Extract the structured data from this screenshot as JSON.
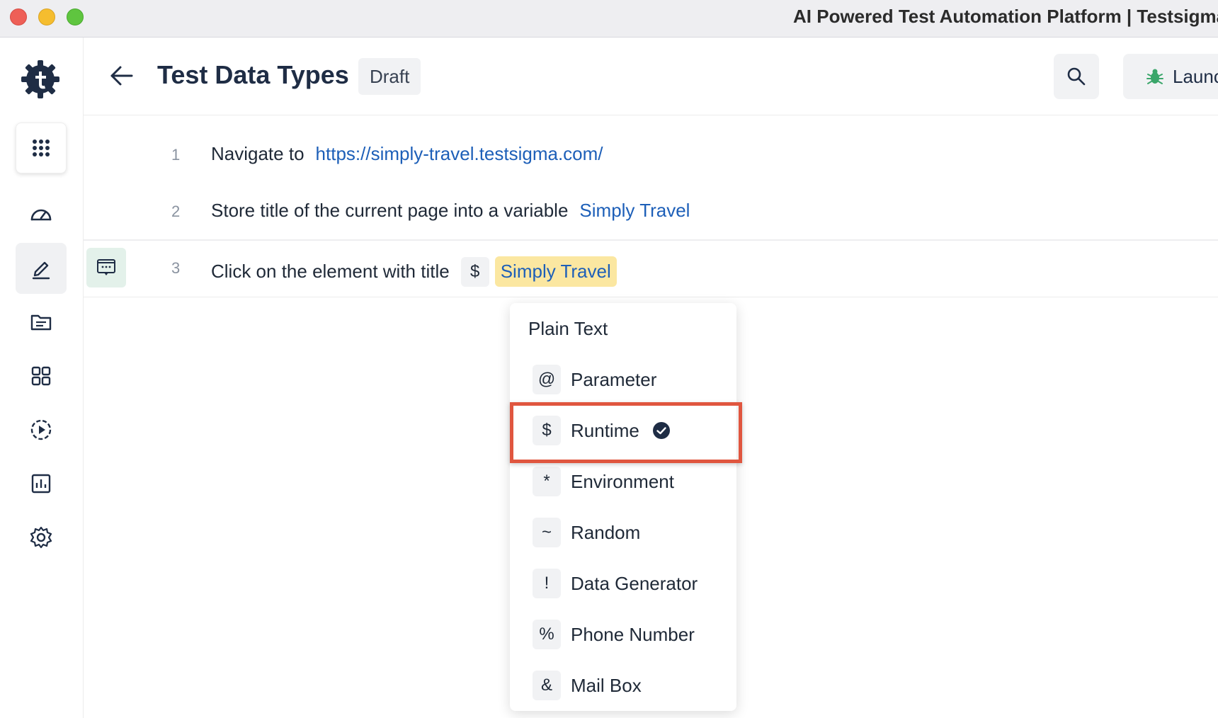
{
  "window": {
    "title": "AI Powered Test Automation Platform | Testsigma"
  },
  "header": {
    "title": "Test Data Types",
    "status_badge": "Draft",
    "launch_label": "Launch"
  },
  "steps": [
    {
      "number": "1",
      "text": "Navigate to",
      "value": "https://simply-travel.testsigma.com/"
    },
    {
      "number": "2",
      "text": "Store title of the current page into a variable",
      "value": "Simply Travel"
    },
    {
      "number": "3",
      "text": "Click on the element with title",
      "prefix": "$",
      "value": "Simply Travel"
    }
  ],
  "dropdown": {
    "items": [
      {
        "label": "Plain Text",
        "symbol": ""
      },
      {
        "label": "Parameter",
        "symbol": "@"
      },
      {
        "label": "Runtime",
        "symbol": "$",
        "selected": true
      },
      {
        "label": "Environment",
        "symbol": "*"
      },
      {
        "label": "Random",
        "symbol": "~"
      },
      {
        "label": "Data Generator",
        "symbol": "!"
      },
      {
        "label": "Phone Number",
        "symbol": "%"
      },
      {
        "label": "Mail Box",
        "symbol": "&"
      }
    ]
  },
  "colors": {
    "accent_link": "#1d5fb8",
    "highlight_bg": "#fbe7a1",
    "annotation_box": "#e0563f",
    "brand_dark": "#1f2d45"
  }
}
